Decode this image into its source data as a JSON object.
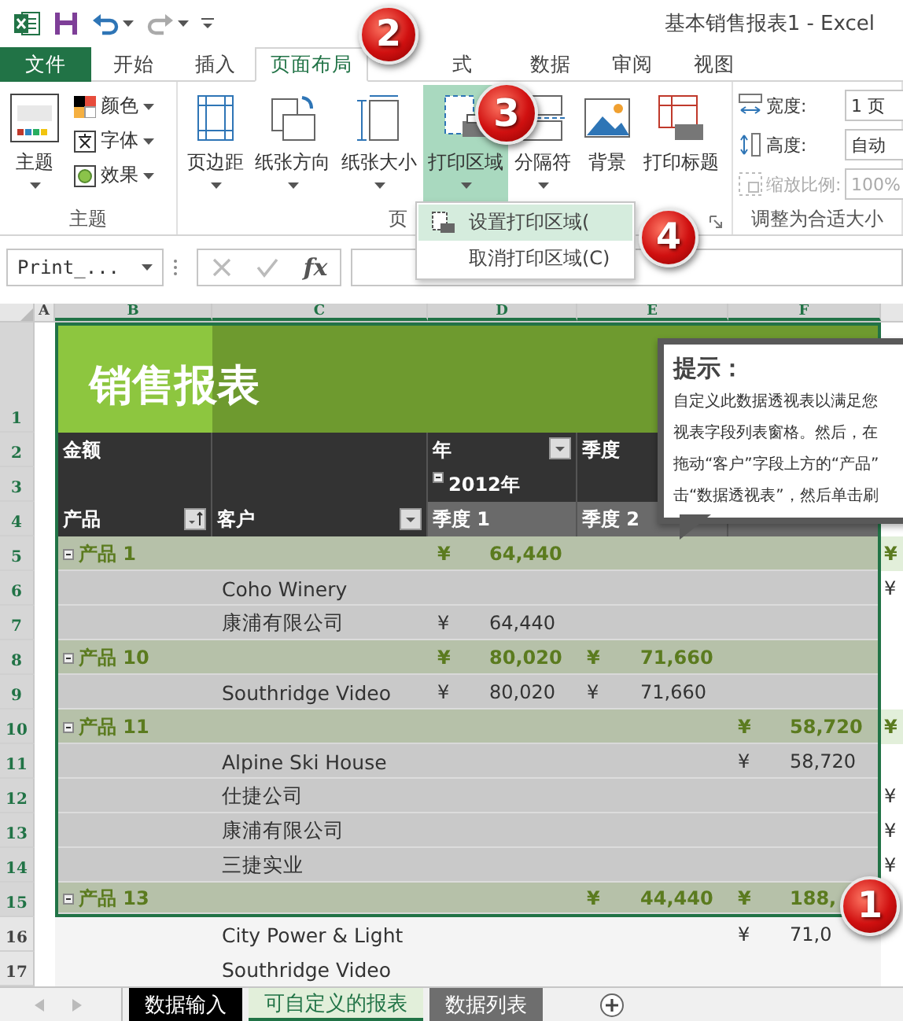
{
  "title_bar": {
    "title": "基本销售报表1 - Excel"
  },
  "tabs": [
    {
      "label": "文件",
      "kind": "file",
      "selected": false
    },
    {
      "label": "开始",
      "kind": "tab",
      "selected": false
    },
    {
      "label": "插入",
      "kind": "tab",
      "selected": false
    },
    {
      "label": "页面布局",
      "kind": "tab",
      "selected": true
    },
    {
      "label": "式",
      "kind": "tab",
      "selected": false
    },
    {
      "label": "数据",
      "kind": "tab",
      "selected": false
    },
    {
      "label": "审阅",
      "kind": "tab",
      "selected": false
    },
    {
      "label": "视图",
      "kind": "tab",
      "selected": false
    }
  ],
  "ribbon": {
    "groups": [
      {
        "label": "主题",
        "buttons": [
          {
            "label": "主题",
            "kind": "large",
            "dropdown": true,
            "selected": false
          },
          {
            "label": "颜色",
            "kind": "small",
            "dropdown": true,
            "selected": false
          },
          {
            "label": "字体",
            "kind": "small",
            "dropdown": true,
            "selected": false
          },
          {
            "label": "效果",
            "kind": "small",
            "dropdown": true,
            "selected": false
          }
        ]
      },
      {
        "label": "页",
        "launcher": true,
        "buttons": [
          {
            "label": "页边距",
            "kind": "large",
            "dropdown": true,
            "selected": false
          },
          {
            "label": "纸张方向",
            "kind": "large",
            "dropdown": true,
            "selected": false
          },
          {
            "label": "纸张大小",
            "kind": "large",
            "dropdown": true,
            "selected": false
          },
          {
            "label": "打印区域",
            "kind": "large",
            "dropdown": true,
            "selected": true
          },
          {
            "label": "分隔符",
            "kind": "large",
            "dropdown": true,
            "selected": false
          },
          {
            "label": "背景",
            "kind": "large",
            "dropdown": false,
            "selected": false
          },
          {
            "label": "打印标题",
            "kind": "large",
            "dropdown": false,
            "selected": false
          }
        ]
      },
      {
        "label": "调整为合适大小",
        "fields": [
          {
            "label": "宽度:",
            "value": "1 页",
            "disabled": false
          },
          {
            "label": "高度:",
            "value": "自动",
            "disabled": false
          },
          {
            "label": "缩放比例:",
            "value": "100%",
            "disabled": true
          }
        ]
      }
    ]
  },
  "menu": {
    "items": [
      {
        "label": "设置打印区域(",
        "selected": true
      },
      {
        "label": "取消打印区域(C)",
        "selected": false
      }
    ]
  },
  "formula_bar": {
    "name_box": "Print_...",
    "function_button": "fx"
  },
  "sheet": {
    "columns": [
      {
        "label": "A",
        "selected": false
      },
      {
        "label": "B",
        "selected": true
      },
      {
        "label": "C",
        "selected": true
      },
      {
        "label": "D",
        "selected": true
      },
      {
        "label": "E",
        "selected": true
      },
      {
        "label": "F",
        "selected": true
      }
    ],
    "rows": [
      {
        "number": "1",
        "kind": "title",
        "in_print_area": true,
        "title": "销售报表"
      },
      {
        "number": "2",
        "kind": "header",
        "in_print_area": true,
        "cells": {
          "B": {
            "text": "金额",
            "filter": false
          },
          "D": {
            "text": "年",
            "filter": true
          },
          "E": {
            "text": "季度",
            "filter": false
          }
        }
      },
      {
        "number": "3",
        "kind": "header",
        "in_print_area": true,
        "cells": {
          "D": {
            "text": "2012年",
            "expanded": true,
            "filter": false
          }
        }
      },
      {
        "number": "4",
        "kind": "subheader",
        "in_print_area": true,
        "cells": {
          "B": {
            "text": "产品",
            "filter": true,
            "sorted": true
          },
          "C": {
            "text": "客户",
            "filter": true,
            "sorted": false
          },
          "D": {
            "text": "季度 1",
            "filter": false
          },
          "E": {
            "text": "季度 2",
            "filter": false
          }
        }
      },
      {
        "number": "5",
        "kind": "group",
        "in_print_area": true,
        "product": "产品 1",
        "expanded": true,
        "values": {
          "D": {
            "currency": "¥",
            "amount": "64,440"
          }
        },
        "column_g": "¥"
      },
      {
        "number": "6",
        "kind": "item",
        "in_print_area": true,
        "customer": "Coho Winery",
        "column_g": "¥"
      },
      {
        "number": "7",
        "kind": "item",
        "in_print_area": true,
        "customer": "康浦有限公司",
        "values": {
          "D": {
            "currency": "¥",
            "amount": "64,440"
          }
        }
      },
      {
        "number": "8",
        "kind": "group",
        "in_print_area": true,
        "product": "产品 10",
        "expanded": true,
        "values": {
          "D": {
            "currency": "¥",
            "amount": "80,020"
          },
          "E": {
            "currency": "¥",
            "amount": "71,660"
          }
        }
      },
      {
        "number": "9",
        "kind": "item",
        "in_print_area": true,
        "customer": "Southridge Video",
        "values": {
          "D": {
            "currency": "¥",
            "amount": "80,020"
          },
          "E": {
            "currency": "¥",
            "amount": "71,660"
          }
        }
      },
      {
        "number": "10",
        "kind": "group",
        "in_print_area": true,
        "product": "产品 11",
        "expanded": true,
        "values": {
          "F": {
            "currency": "¥",
            "amount": "58,720"
          }
        },
        "column_g": "¥"
      },
      {
        "number": "11",
        "kind": "item",
        "in_print_area": true,
        "customer": "Alpine Ski House",
        "values": {
          "F": {
            "currency": "¥",
            "amount": "58,720"
          }
        }
      },
      {
        "number": "12",
        "kind": "item",
        "in_print_area": true,
        "customer": "仕捷公司",
        "column_g": "¥"
      },
      {
        "number": "13",
        "kind": "item",
        "in_print_area": true,
        "customer": "康浦有限公司",
        "column_g": "¥"
      },
      {
        "number": "14",
        "kind": "item",
        "in_print_area": true,
        "customer": "三捷实业",
        "column_g": "¥"
      },
      {
        "number": "15",
        "kind": "group",
        "in_print_area": true,
        "product": "产品 13",
        "expanded": true,
        "values": {
          "E": {
            "currency": "¥",
            "amount": "44,440"
          },
          "F": {
            "currency": "¥",
            "amount": "188,"
          }
        }
      },
      {
        "number": "16",
        "kind": "plain",
        "in_print_area": false,
        "customer": "City Power & Light",
        "values": {
          "F": {
            "currency": "¥",
            "amount": "71,0"
          }
        }
      },
      {
        "number": "17",
        "kind": "plain",
        "in_print_area": false,
        "customer": "Southridge Video"
      }
    ]
  },
  "tooltip": {
    "title": "提示：",
    "lines": [
      "自定义此数据透视表以满足您",
      "视表字段列表窗格。然后，在",
      "拖动“客户”字段上方的“产品”",
      "击“数据透视表”，然后单击刷"
    ]
  },
  "sheet_tabs": [
    {
      "label": "数据输入",
      "color": "#000000",
      "selected": false
    },
    {
      "label": "可自定义的报表",
      "color": "#e2efda",
      "selected": true
    },
    {
      "label": "数据列表",
      "color": "#6e6e6e",
      "selected": false
    }
  ],
  "callouts": [
    {
      "number": "2"
    },
    {
      "number": "3"
    },
    {
      "number": "4"
    },
    {
      "number": "1"
    }
  ]
}
